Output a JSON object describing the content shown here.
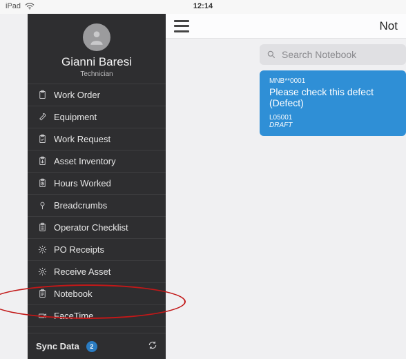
{
  "status": {
    "device": "iPad",
    "time": "12:14"
  },
  "user": {
    "name": "Gianni Baresi",
    "role": "Technician"
  },
  "menu": [
    {
      "id": "work-order",
      "label": "Work Order",
      "icon": "clipboard"
    },
    {
      "id": "equipment",
      "label": "Equipment",
      "icon": "wrench"
    },
    {
      "id": "work-request",
      "label": "Work Request",
      "icon": "clipboard-check"
    },
    {
      "id": "asset-inventory",
      "label": "Asset Inventory",
      "icon": "clipboard-down"
    },
    {
      "id": "hours-worked",
      "label": "Hours Worked",
      "icon": "clipboard-clock"
    },
    {
      "id": "breadcrumbs",
      "label": "Breadcrumbs",
      "icon": "pin"
    },
    {
      "id": "operator-checklist",
      "label": "Operator Checklist",
      "icon": "clipboard-list"
    },
    {
      "id": "po-receipts",
      "label": "PO Receipts",
      "icon": "gear"
    },
    {
      "id": "receive-asset",
      "label": "Receive Asset",
      "icon": "gear"
    },
    {
      "id": "notebook",
      "label": "Notebook",
      "icon": "clipboard"
    },
    {
      "id": "facetime",
      "label": "FaceTime",
      "icon": "camera"
    }
  ],
  "sync": {
    "label": "Sync Data",
    "count": "2"
  },
  "main": {
    "title_partial": "Not",
    "search_placeholder": "Search Notebook",
    "card": {
      "code": "MNB**0001",
      "title": "Please check this defect (Defect)",
      "sub": "L05001",
      "status": "DRAFT"
    }
  }
}
